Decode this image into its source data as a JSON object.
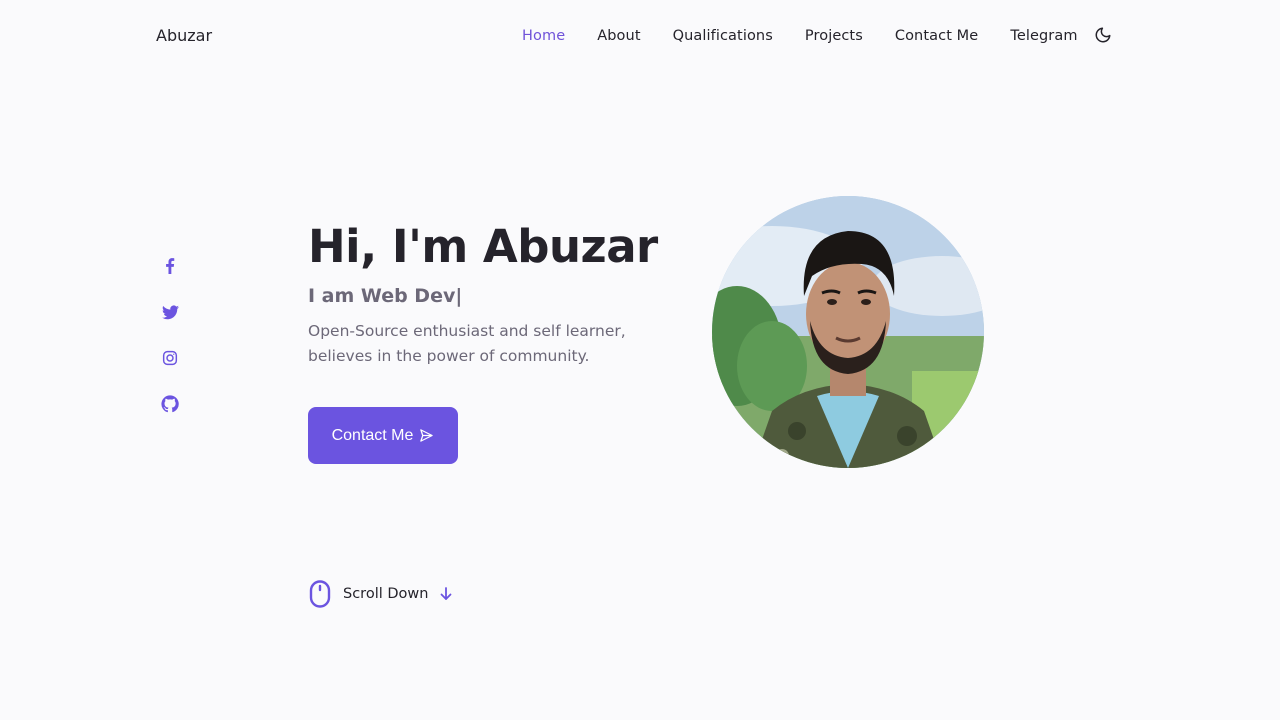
{
  "header": {
    "logo": "Abuzar",
    "nav": [
      {
        "label": "Home",
        "active": true
      },
      {
        "label": "About",
        "active": false
      },
      {
        "label": "Qualifications",
        "active": false
      },
      {
        "label": "Projects",
        "active": false
      },
      {
        "label": "Contact Me",
        "active": false
      },
      {
        "label": "Telegram",
        "active": false
      }
    ],
    "theme_icon": "moon-icon"
  },
  "socials": [
    {
      "icon": "facebook-icon"
    },
    {
      "icon": "twitter-icon"
    },
    {
      "icon": "instagram-icon"
    },
    {
      "icon": "github-icon"
    }
  ],
  "hero": {
    "title": "Hi, I'm Abuzar",
    "subtitle": "I am Web Dev|",
    "description": "Open-Source enthusiast and self learner, believes in the power of community.",
    "cta_label": "Contact Me",
    "cta_icon": "send-icon",
    "avatar_icon": "profile-photo"
  },
  "scroll": {
    "label": "Scroll Down",
    "mouse_icon": "mouse-icon",
    "arrow_icon": "arrow-down-icon"
  },
  "colors": {
    "accent": "#6b54e0",
    "active_nav": "#7053d9",
    "text": "#25232b",
    "muted": "#6c6878",
    "background": "#fafafc"
  }
}
